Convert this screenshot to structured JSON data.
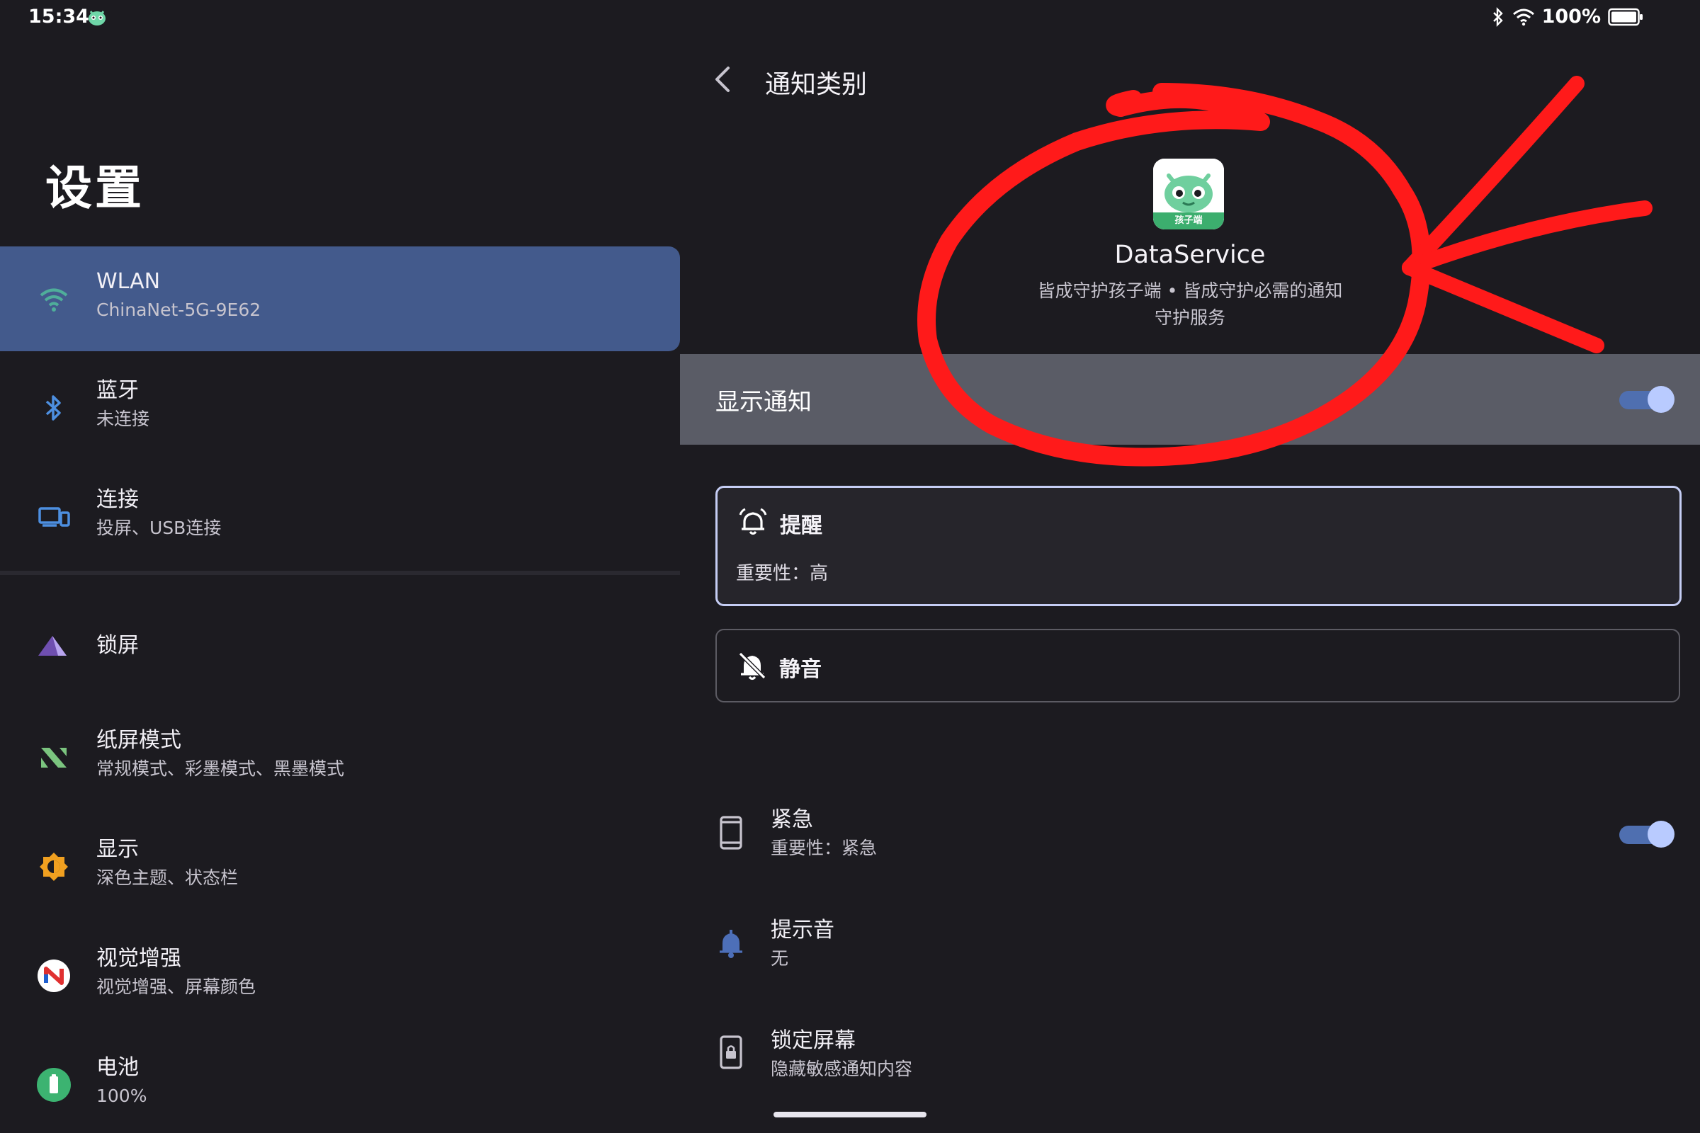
{
  "status_bar": {
    "time": "15:34",
    "battery_text": "100%",
    "icons": [
      "app-notification-icon",
      "bluetooth-icon",
      "wifi-icon",
      "battery-icon"
    ]
  },
  "settings": {
    "title": "设置",
    "items": [
      {
        "title": "WLAN",
        "subtitle": "ChinaNet-5G-9E62",
        "icon": "wifi-icon",
        "selected": true
      },
      {
        "title": "蓝牙",
        "subtitle": "未连接",
        "icon": "bluetooth-icon"
      },
      {
        "title": "连接",
        "subtitle": "投屏、USB连接",
        "icon": "devices-icon"
      },
      {
        "title": "锁屏",
        "subtitle": "",
        "icon": "lock-screen-icon"
      },
      {
        "title": "纸屏模式",
        "subtitle": "常规模式、彩墨模式、黑墨模式",
        "icon": "paper-mode-icon"
      },
      {
        "title": "显示",
        "subtitle": "深色主题、状态栏",
        "icon": "display-icon"
      },
      {
        "title": "视觉增强",
        "subtitle": "视觉增强、屏幕颜色",
        "icon": "visual-enhance-icon"
      },
      {
        "title": "电池",
        "subtitle": "100%",
        "icon": "battery-icon"
      }
    ]
  },
  "detail": {
    "page_title": "通知类别",
    "app_name": "DataService",
    "app_icon_label": "孩子端",
    "app_desc_line1": "皆成守护孩子端 • 皆成守护必需的通知",
    "app_desc_line2": "守护服务",
    "show_notifications_label": "显示通知",
    "show_notifications_on": true,
    "alert_option": {
      "title": "提醒",
      "subtitle": "重要性：高",
      "selected": true
    },
    "silent_option": {
      "title": "静音",
      "selected": false
    },
    "rows": [
      {
        "title": "紧急",
        "subtitle": "重要性：紧急",
        "toggle": true
      },
      {
        "title": "提示音",
        "subtitle": "无"
      },
      {
        "title": "锁定屏幕",
        "subtitle": "隐藏敏感通知内容"
      }
    ]
  },
  "colors": {
    "background": "#1c1b20",
    "selected_item": "#435a8c",
    "highlight_bar": "#5a5c66",
    "toggle_track": "#4f6fb0",
    "toggle_thumb": "#b9cbff",
    "annotation_red": "#ff1a1a"
  }
}
